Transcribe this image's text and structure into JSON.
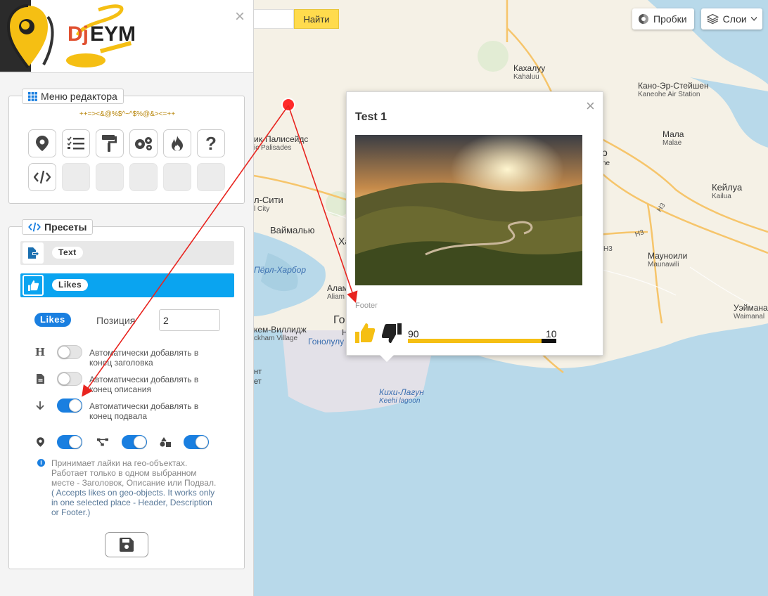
{
  "logo": {
    "text_dj": "Dj",
    "text_eym": "EYM"
  },
  "panel": {
    "close_glyph": "×",
    "menu_title": "Меню редактора",
    "special_chars": "++=><&@%$^~^$%@&><=++",
    "tools": [
      {
        "icon": "map-marker-icon"
      },
      {
        "icon": "checklist-icon"
      },
      {
        "icon": "paint-roller-icon"
      },
      {
        "icon": "gears-icon"
      },
      {
        "icon": "fire-icon"
      },
      {
        "icon": "question-icon"
      },
      {
        "icon": "code-icon"
      },
      {
        "icon": "empty"
      },
      {
        "icon": "empty"
      },
      {
        "icon": "empty"
      },
      {
        "icon": "empty"
      },
      {
        "icon": "empty"
      }
    ],
    "presets_title": "Пресеты",
    "presets": [
      {
        "label": "Text",
        "icon": "file-arrow-icon",
        "active": false
      },
      {
        "label": "Likes",
        "icon": "thumbs-up-icon",
        "active": true
      }
    ],
    "likes_tag": "Likes",
    "position_label": "Позиция",
    "position_value": "2",
    "options": [
      {
        "icon": "H",
        "label": "Автоматически добавлять в конец заголовка",
        "enabled": false
      },
      {
        "icon": "file-icon",
        "label": "Автоматически добавлять в конец описания",
        "enabled": false
      },
      {
        "icon": "arrow-down-icon",
        "label": "Автоматически добавлять в конец подвала",
        "enabled": true
      }
    ],
    "geo_toggles": [
      {
        "icon": "map-marker-icon",
        "enabled": true
      },
      {
        "icon": "polyline-icon",
        "enabled": true
      },
      {
        "icon": "shapes-icon",
        "enabled": true
      }
    ],
    "info_ru": "Принимает лайки на гео-объектах. Работает только в одном выбранном месте - Заголовок, Описание или Подвал.",
    "info_en": "( Accepts likes on geo-objects. It works only in one selected place - Header, Description or Footer.)"
  },
  "map": {
    "search_button": "Найти",
    "traffic_button": "Пробки",
    "layers_button": "Слои",
    "labels": [
      {
        "main": "Кахалуу",
        "sub": "Kahaluu"
      },
      {
        "main": "Кано-Эр-Стейшен",
        "sub": "Kaneohe Air Station"
      },
      {
        "main": "Мала",
        "sub": "Malae"
      },
      {
        "main": "Кейлуа",
        "sub": "Kailua"
      },
      {
        "main": "Мауноили",
        "sub": "Maunawili"
      },
      {
        "main": "Уэйманал",
        "sub": "Waimanal"
      },
      {
        "main": "ик-Палисейдс",
        "sub": "ic Palisades"
      },
      {
        "main": "л-Сити",
        "sub": "l City"
      },
      {
        "main": "Ваймалью",
        "sub": ""
      },
      {
        "main": "Пёрл-Харбор",
        "sub": ""
      },
      {
        "main": "Алам",
        "sub": "Aliam"
      },
      {
        "main": "кем-Виллидж",
        "sub": "ckham Village"
      },
      {
        "main": "Гонолулу",
        "sub": ""
      },
      {
        "main": "Кихи-Лагун",
        "sub": "Keehi lagoon"
      }
    ],
    "road_labels": [
      "H3",
      "H3",
      "H3"
    ],
    "fragment_labels": [
      "Ха",
      "Го",
      "Н",
      "о",
      "he",
      "нт",
      "ет"
    ]
  },
  "balloon": {
    "close_glyph": "×",
    "title": "Test 1",
    "footer": "Footer",
    "likes": "90",
    "dislikes": "10",
    "like_ratio": 0.9
  },
  "colors": {
    "accent_blue": "#1a7fe0",
    "preset_active": "#0aa4f0",
    "search_yellow": "#ffdb4d",
    "like_yellow": "#f5bf13",
    "marker_red": "#ff2a2a",
    "map_water": "#b8d9ea",
    "map_land": "#f5f1e6"
  }
}
